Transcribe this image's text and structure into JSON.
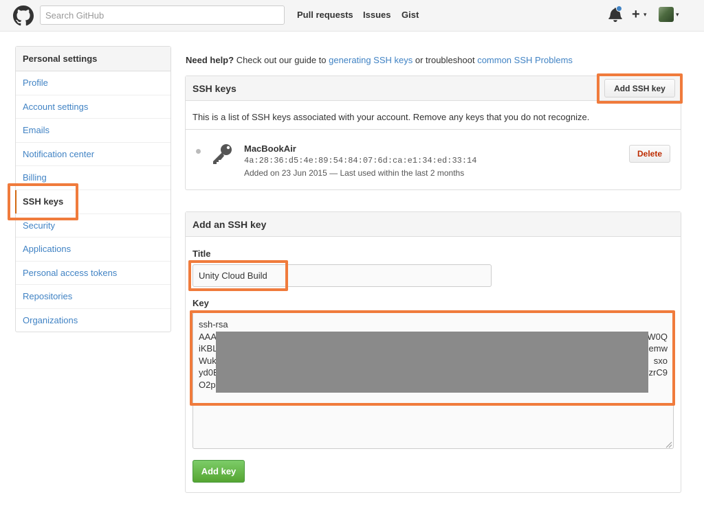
{
  "header": {
    "search_placeholder": "Search GitHub",
    "nav": [
      "Pull requests",
      "Issues",
      "Gist"
    ],
    "new_symbol": "+",
    "caret": "▾"
  },
  "sidebar": {
    "title": "Personal settings",
    "items": [
      {
        "label": "Profile"
      },
      {
        "label": "Account settings"
      },
      {
        "label": "Emails"
      },
      {
        "label": "Notification center"
      },
      {
        "label": "Billing"
      },
      {
        "label": "SSH keys"
      },
      {
        "label": "Security"
      },
      {
        "label": "Applications"
      },
      {
        "label": "Personal access tokens"
      },
      {
        "label": "Repositories"
      },
      {
        "label": "Organizations"
      }
    ]
  },
  "help": {
    "lead": "Need help?",
    "text1": " Check out our guide to ",
    "link1": "generating SSH keys",
    "text2": " or troubleshoot ",
    "link2": "common SSH Problems"
  },
  "ssh_keys": {
    "title": "SSH keys",
    "add_button": "Add SSH key",
    "description": "This is a list of SSH keys associated with your account. Remove any keys that you do not recognize.",
    "key": {
      "name": "MacBookAir",
      "fingerprint": "4a:28:36:d5:4e:89:54:84:07:6d:ca:e1:34:ed:33:14",
      "meta": "Added on 23 Jun 2015 — Last used within the last 2 months",
      "delete_label": "Delete"
    }
  },
  "add_key": {
    "title": "Add an SSH key",
    "title_label": "Title",
    "title_value": "Unity Cloud Build",
    "key_label": "Key",
    "key_lines": [
      "ssh-rsa",
      "AAA",
      "iKBL",
      "Wuk",
      "yd0E",
      "O2p"
    ],
    "key_line_ends": [
      "W0Q",
      "emw",
      "sxo",
      "zrC9"
    ],
    "submit_label": "Add key"
  },
  "colors": {
    "link": "#4183c4",
    "highlight": "#f07b3c",
    "green": "#55a532",
    "delete_red": "#bd2c00"
  }
}
